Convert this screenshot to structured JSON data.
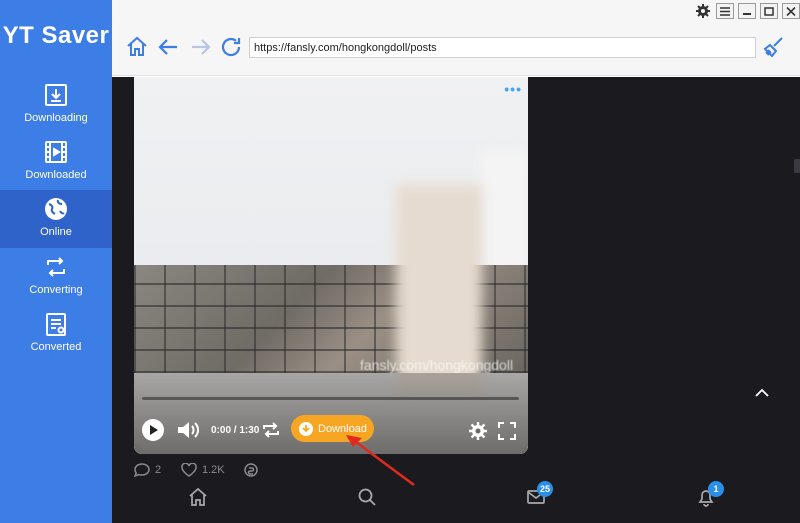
{
  "app": {
    "name": "YT Saver"
  },
  "sidebar": {
    "items": [
      {
        "label": "Downloading",
        "icon": "download-icon"
      },
      {
        "label": "Downloaded",
        "icon": "film-icon"
      },
      {
        "label": "Online",
        "icon": "globe-icon",
        "active": true
      },
      {
        "label": "Converting",
        "icon": "convert-icon"
      },
      {
        "label": "Converted",
        "icon": "document-icon"
      }
    ]
  },
  "toolbar": {
    "url": "https://fansly.com/hongkongdoll/posts",
    "icons": [
      "home-icon",
      "back-icon",
      "forward-icon",
      "refresh-icon",
      "broom-icon"
    ]
  },
  "window_controls": [
    "settings-icon",
    "menu-icon",
    "minimize-icon",
    "maximize-icon",
    "close-icon"
  ],
  "video": {
    "time": "0:00 / 1:30",
    "download_label": "Download",
    "watermark": "fansly.com/hongkongdoll"
  },
  "post_stats": {
    "comments": "2",
    "likes": "1.2K"
  },
  "bottom_nav": {
    "messages_badge": "25",
    "notifications_badge": "1"
  },
  "colors": {
    "sidebar": "#3d7de6",
    "sidebar_active": "#2f63c9",
    "content_bg": "#1b1b1f",
    "accent": "#f6a623",
    "link_blue": "#2b8fe8"
  }
}
